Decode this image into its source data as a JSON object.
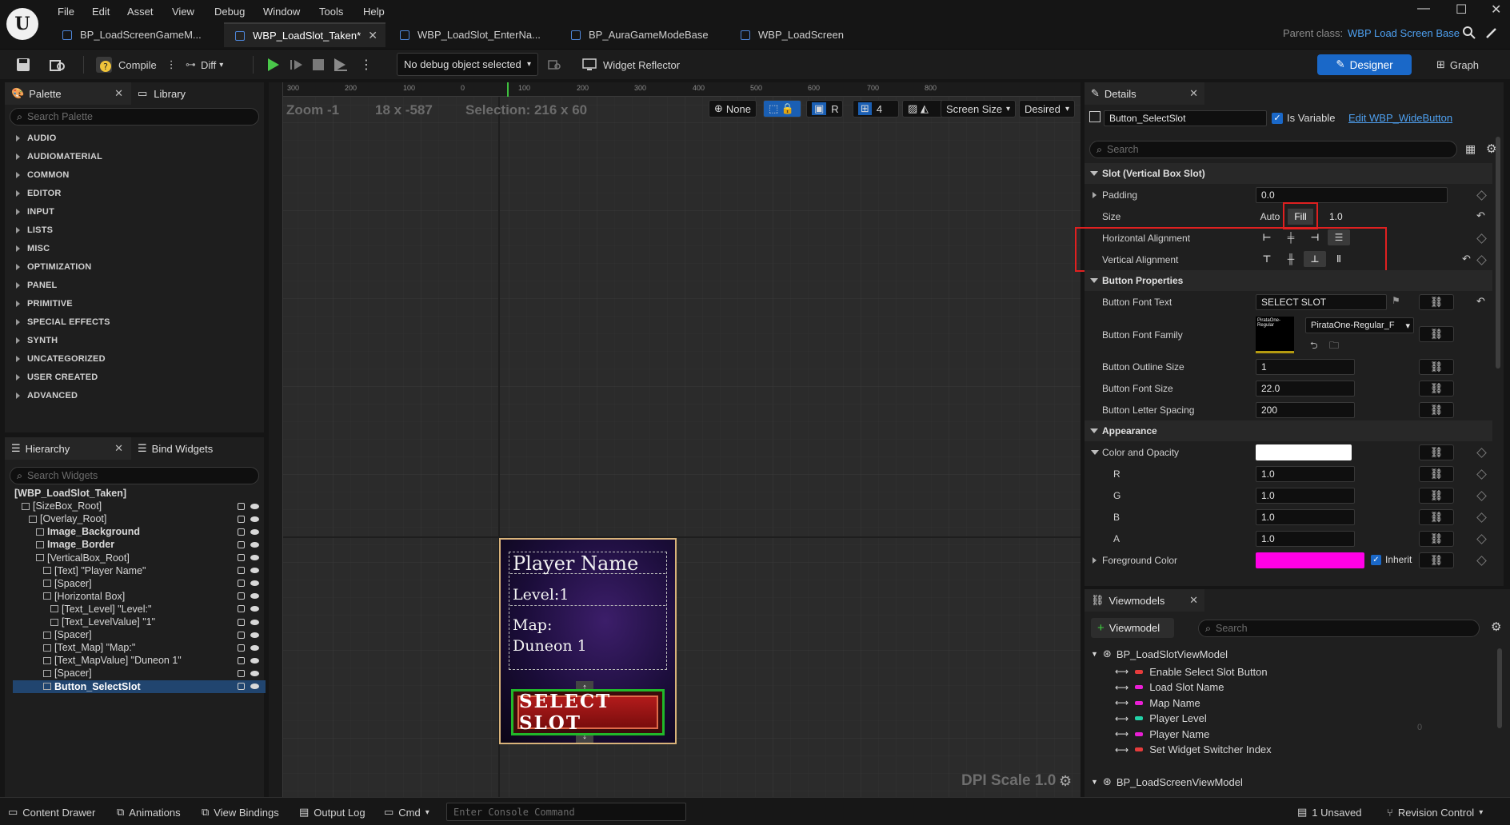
{
  "menu": [
    "File",
    "Edit",
    "Asset",
    "View",
    "Debug",
    "Window",
    "Tools",
    "Help"
  ],
  "tabs": [
    {
      "label": "BP_LoadScreenGameM...",
      "active": false
    },
    {
      "label": "WBP_LoadSlot_Taken*",
      "active": true
    },
    {
      "label": "WBP_LoadSlot_EnterNa...",
      "active": false
    },
    {
      "label": "BP_AuraGameModeBase",
      "active": false
    },
    {
      "label": "WBP_LoadScreen",
      "active": false
    }
  ],
  "parent_class": {
    "label": "Parent class:",
    "value": "WBP Load Screen Base"
  },
  "toolbar": {
    "compile": "Compile",
    "diff": "Diff",
    "debug_object": "No debug object selected",
    "widget_reflector": "Widget Reflector",
    "designer": "Designer",
    "graph": "Graph"
  },
  "palette": {
    "tab": "Palette",
    "library_tab": "Library",
    "search_placeholder": "Search Palette",
    "categories": [
      "AUDIO",
      "AUDIOMATERIAL",
      "COMMON",
      "EDITOR",
      "INPUT",
      "LISTS",
      "MISC",
      "OPTIMIZATION",
      "PANEL",
      "PRIMITIVE",
      "SPECIAL EFFECTS",
      "SYNTH",
      "UNCATEGORIZED",
      "USER CREATED",
      "ADVANCED"
    ]
  },
  "hierarchy": {
    "tab": "Hierarchy",
    "bind_tab": "Bind Widgets",
    "search_placeholder": "Search Widgets",
    "items": [
      {
        "label": "[WBP_LoadSlot_Taken]",
        "depth": 0,
        "bold": true
      },
      {
        "label": "[SizeBox_Root]",
        "depth": 1
      },
      {
        "label": "[Overlay_Root]",
        "depth": 2
      },
      {
        "label": "Image_Background",
        "depth": 3,
        "bold": true
      },
      {
        "label": "Image_Border",
        "depth": 3,
        "bold": true
      },
      {
        "label": "[VerticalBox_Root]",
        "depth": 3
      },
      {
        "label": "[Text] \"Player Name\"",
        "depth": 4
      },
      {
        "label": "[Spacer]",
        "depth": 4
      },
      {
        "label": "[Horizontal Box]",
        "depth": 4
      },
      {
        "label": "[Text_Level] \"Level:\"",
        "depth": 5
      },
      {
        "label": "[Text_LevelValue] \"1\"",
        "depth": 5
      },
      {
        "label": "[Spacer]",
        "depth": 4
      },
      {
        "label": "[Text_Map] \"Map:\"",
        "depth": 4
      },
      {
        "label": "[Text_MapValue] \"Duneon 1\"",
        "depth": 4
      },
      {
        "label": "[Spacer]",
        "depth": 4
      },
      {
        "label": "Button_SelectSlot",
        "depth": 4,
        "bold": true,
        "selected": true
      }
    ]
  },
  "canvas": {
    "zoom": "Zoom -1",
    "coords": "18 x -587",
    "selection": "Selection: 216 x 60",
    "none": "None",
    "r": "R",
    "grid": "4",
    "screen_size": "Screen Size",
    "desired": "Desired",
    "dpi": "DPI Scale 1.0",
    "ruler_h": [
      "300",
      "200",
      "100",
      "0",
      "100",
      "200",
      "300",
      "400",
      "500",
      "600",
      "700",
      "800"
    ],
    "widget": {
      "player_name": "Player Name",
      "level": "Level:1",
      "map": "Map:",
      "map_value": "Duneon 1",
      "button": "SELECT SLOT"
    }
  },
  "details": {
    "tab": "Details",
    "widget_name": "Button_SelectSlot",
    "is_variable": "Is Variable",
    "edit_link": "Edit WBP_WideButton",
    "search_placeholder": "Search",
    "slot_section": "Slot (Vertical Box Slot)",
    "padding": {
      "label": "Padding",
      "value": "0.0"
    },
    "size": {
      "label": "Size",
      "auto": "Auto",
      "fill": "Fill",
      "value": "1.0"
    },
    "h_align": "Horizontal Alignment",
    "v_align": "Vertical Alignment",
    "button_section": "Button Properties",
    "button_font_text": {
      "label": "Button Font Text",
      "value": "SELECT SLOT"
    },
    "button_font_family": {
      "label": "Button Font Family",
      "value": "PirataOne-Regular_F",
      "thumb": "PirataOne-Regular"
    },
    "outline_size": {
      "label": "Button Outline Size",
      "value": "1"
    },
    "font_size": {
      "label": "Button Font Size",
      "value": "22.0"
    },
    "letter_spacing": {
      "label": "Button Letter Spacing",
      "value": "200"
    },
    "appearance_section": "Appearance",
    "color_opacity": "Color and Opacity",
    "r": {
      "label": "R",
      "value": "1.0"
    },
    "g": {
      "label": "G",
      "value": "1.0"
    },
    "b": {
      "label": "B",
      "value": "1.0"
    },
    "a": {
      "label": "A",
      "value": "1.0"
    },
    "foreground": {
      "label": "Foreground Color",
      "inherit": "Inherit"
    },
    "colors": {
      "color_opacity": "#ffffff",
      "foreground": "#ff00e6"
    }
  },
  "viewmodels": {
    "tab": "Viewmodels",
    "add_button": "Viewmodel",
    "search_placeholder": "Search",
    "vm1": "BP_LoadSlotViewModel",
    "bindings": [
      {
        "label": "Enable Select Slot Button",
        "color": "#e63c3c"
      },
      {
        "label": "Load Slot Name",
        "color": "#e91fd5"
      },
      {
        "label": "Map Name",
        "color": "#e91fd5"
      },
      {
        "label": "Player Level",
        "color": "#23d3a8"
      },
      {
        "label": "Player Name",
        "color": "#e91fd5"
      },
      {
        "label": "Set Widget Switcher Index",
        "color": "#e63c3c"
      }
    ],
    "player_level_value": "0",
    "vm2": "BP_LoadScreenViewModel"
  },
  "status": {
    "content_drawer": "Content Drawer",
    "animations": "Animations",
    "view_bindings": "View Bindings",
    "output_log": "Output Log",
    "cmd": "Cmd",
    "console_placeholder": "Enter Console Command",
    "unsaved": "1 Unsaved",
    "revision": "Revision Control"
  }
}
